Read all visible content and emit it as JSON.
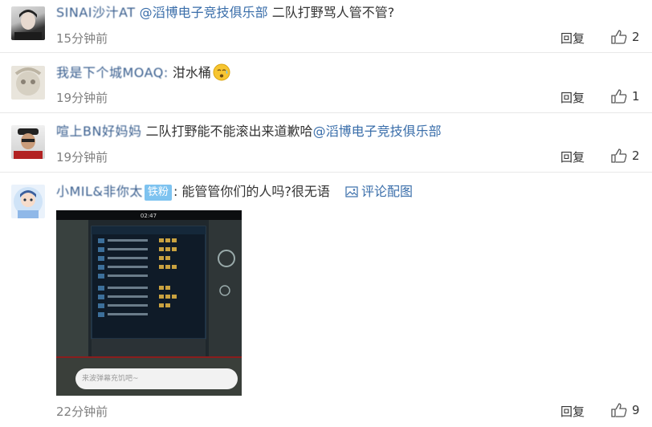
{
  "comments": [
    {
      "username": "SINAI沙汁AT",
      "mention": "@滔博电子竞技俱乐部",
      "text": "二队打野骂人管不管?",
      "time": "15分钟前",
      "reply_label": "回复",
      "likes": "2"
    },
    {
      "username": "我是下个城MOAQ:",
      "text": "泔水桶",
      "time": "19分钟前",
      "reply_label": "回复",
      "likes": "1"
    },
    {
      "username": "喧上BN好妈妈",
      "text": "二队打野能不能滚出来道歉哈",
      "mention": "@滔博电子竞技俱乐部",
      "time": "19分钟前",
      "reply_label": "回复",
      "likes": "2"
    },
    {
      "username": "小MIL&非你太",
      "badge": "铁粉",
      "colon": ":",
      "text": "能管管你们的人吗?很无语",
      "pic_link": "评论配图",
      "time": "22分钟前",
      "reply_label": "回复",
      "likes": "9",
      "image_caption": "来波弹幕充饥吧~",
      "image_clock": "02:47"
    }
  ],
  "colors": {
    "link": "#3a6eaa",
    "time": "#808080",
    "badge": "#7ec3f0"
  },
  "icons": {
    "like": "thumbs-up-icon",
    "picture": "image-icon",
    "emoji": "crying-face-icon"
  }
}
